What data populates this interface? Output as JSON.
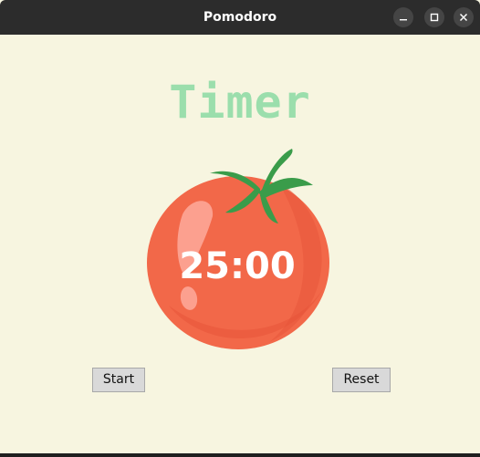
{
  "window": {
    "title": "Pomodoro",
    "controls": {
      "minimize_icon": "minimize-icon",
      "maximize_icon": "maximize-icon",
      "close_icon": "close-icon"
    }
  },
  "main": {
    "heading": "Timer",
    "timer_display": "25:00",
    "tomato_image": "tomato-image",
    "start_label": "Start",
    "reset_label": "Reset"
  },
  "colors": {
    "background": "#f7f5e0",
    "heading_green": "#9bdeac",
    "tomato_red": "#f26849",
    "leaf_green": "#3a9c4a",
    "titlebar": "#2c2c2c"
  }
}
